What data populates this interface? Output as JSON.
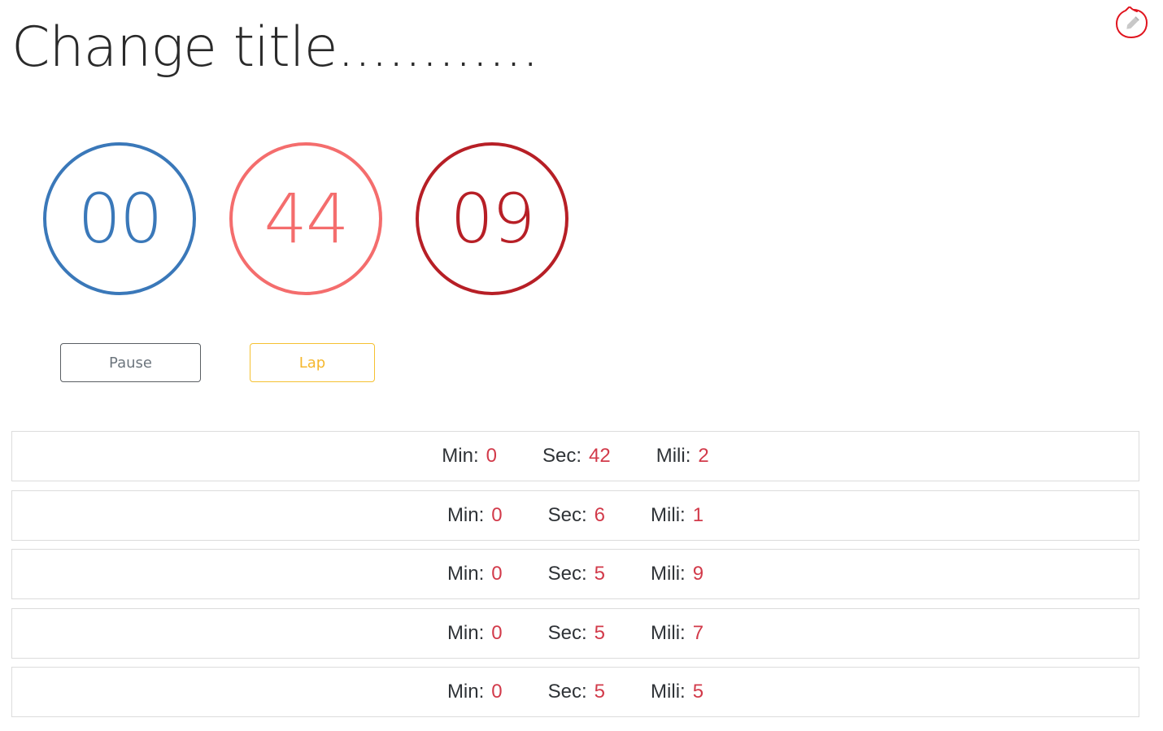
{
  "header": {
    "title": "Change title............"
  },
  "edit_button": {
    "icon": "pencil-icon",
    "annotation_color": "#e0141e"
  },
  "timer": {
    "minutes": "00",
    "seconds": "44",
    "millis": "09",
    "colors": {
      "minutes": "#3a78b9",
      "seconds": "#f46d6d",
      "millis": "#b71f26"
    }
  },
  "controls": {
    "pause_label": "Pause",
    "lap_label": "Lap"
  },
  "labels": {
    "min": "Min:",
    "sec": "Sec:",
    "mili": "Mili:"
  },
  "laps": [
    {
      "min": "0",
      "sec": "42",
      "mili": "2"
    },
    {
      "min": "0",
      "sec": "6",
      "mili": "1"
    },
    {
      "min": "0",
      "sec": "5",
      "mili": "9"
    },
    {
      "min": "0",
      "sec": "5",
      "mili": "7"
    },
    {
      "min": "0",
      "sec": "5",
      "mili": "5"
    }
  ]
}
